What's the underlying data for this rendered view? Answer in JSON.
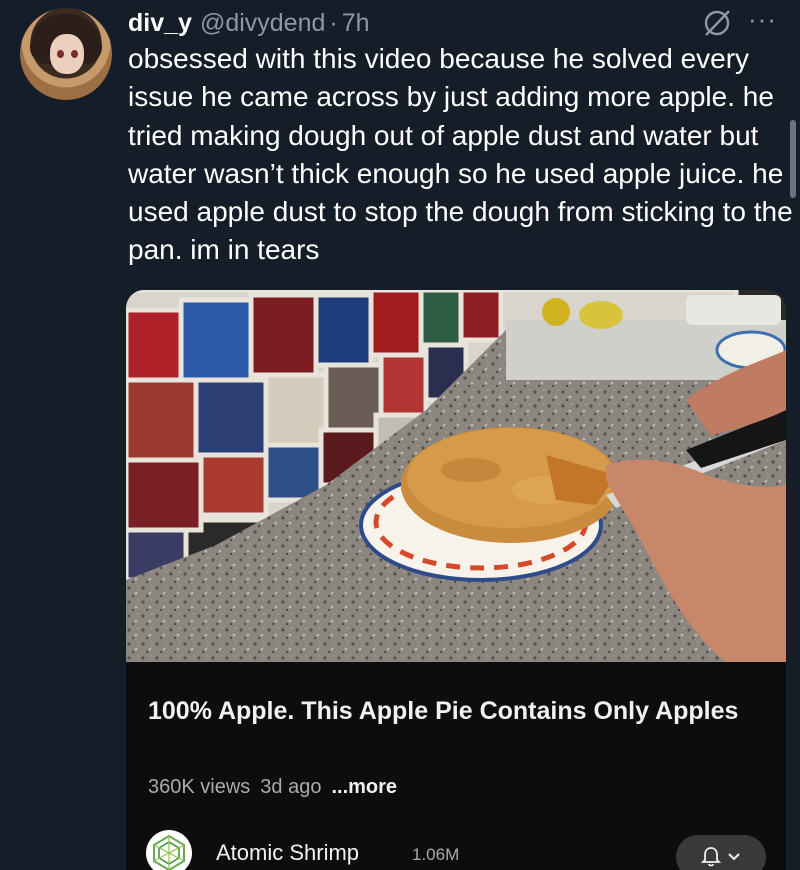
{
  "tweet": {
    "display_name": "div_y",
    "handle": "@divydend",
    "separator": "·",
    "time": "7h",
    "more_icon": "more-horizontal-icon",
    "grok_icon": "grok-icon",
    "text": "obsessed with this video because he solved every issue he came across by just adding more apple. he tried making dough out of apple dust and water but water wasn’t thick enough so he used apple juice. he used apple dust to stop the dough from sticking to the pan. im in tears"
  },
  "video": {
    "title": "100% Apple. This Apple Pie Contains Only Apples",
    "views": "360K views",
    "age": "3d ago",
    "more_label": "...more",
    "channel": "Atomic Shrimp",
    "subscribers": "1.06M",
    "bell_icon": "bell-icon",
    "chevron_icon": "chevron-down-icon"
  },
  "colors": {
    "background": "#151d28",
    "card": "#0d0d0f",
    "secondary_text": "#8b98a5"
  }
}
